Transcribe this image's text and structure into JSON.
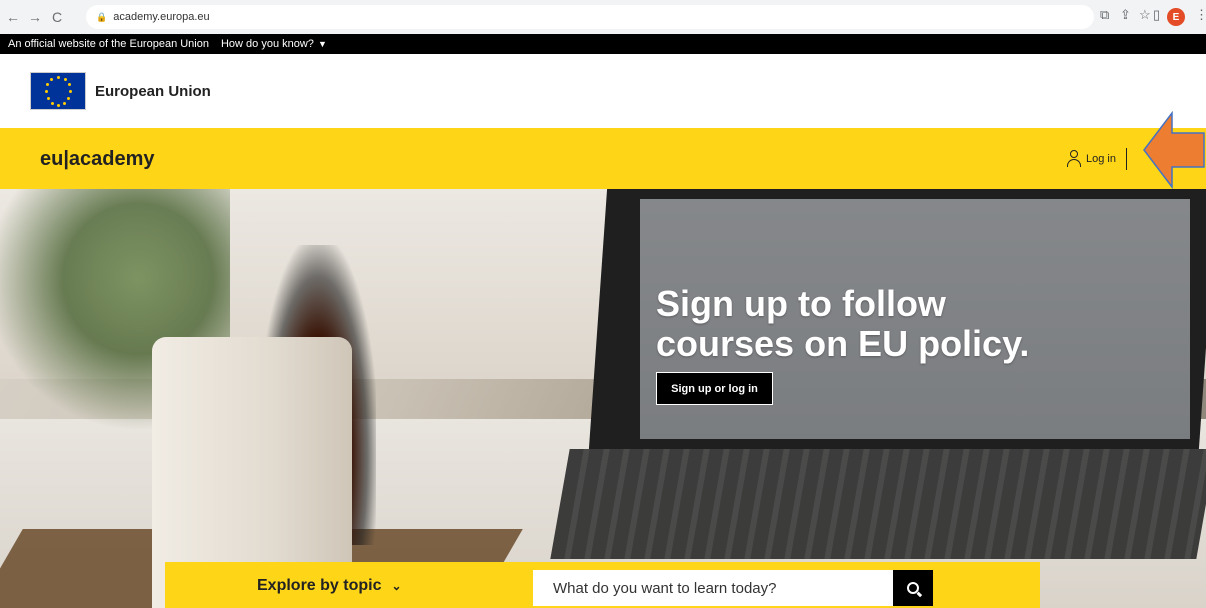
{
  "browser": {
    "url": "academy.europa.eu",
    "back_icon": "←",
    "forward_icon": "→",
    "reload_icon": "C",
    "profile_initial": "E"
  },
  "eu_bar": {
    "official_text": "An official website of the European Union",
    "how_text": "How do you know?"
  },
  "eu_header": {
    "name": "European Union"
  },
  "site_header": {
    "brand": "eu|academy",
    "login_label": "Log in"
  },
  "hero": {
    "headline_line1": "Sign up to follow",
    "headline_line2": "courses on EU policy.",
    "cta_label": "Sign up or log in"
  },
  "search": {
    "topic_label": "Explore by topic",
    "placeholder": "What do you want to learn today?"
  },
  "colors": {
    "accent_yellow": "#ffd617",
    "eu_blue": "#003399",
    "arrow_orange": "#ed7d31"
  }
}
